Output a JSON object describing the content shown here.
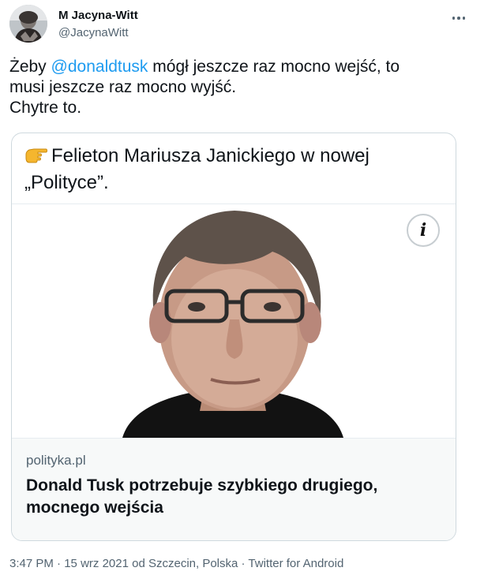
{
  "author": {
    "display_name": "M Jacyna-Witt",
    "handle": "@JacynaWitt"
  },
  "tweet": {
    "line1_prefix": "Żeby ",
    "mention": "@donaldtusk",
    "line1_suffix": " mógł jeszcze raz mocno wejść, to",
    "line2": "musi jeszcze raz mocno wyjść.",
    "line3": "Chytre to."
  },
  "card": {
    "headline_line1": "Felieton Mariusza Janickiego w nowej",
    "headline_line2": "„Polityce”.",
    "info_label": "i",
    "domain": "polityka.pl",
    "title_line1": "Donald Tusk potrzebuje szybkiego drugiego,",
    "title_line2": "mocnego wejścia"
  },
  "meta": {
    "time": "3:47 PM",
    "sep1": " · ",
    "date": "15 wrz 2021",
    "location_prefix": " od ",
    "location": "Szczecin, Polska",
    "sep2": " · ",
    "client": "Twitter for Android"
  },
  "icons": {
    "more": "more-icon",
    "hand": "pointing-hand-icon",
    "info": "info-icon"
  },
  "colors": {
    "accent": "#1d9bf0",
    "secondary_text": "#536471",
    "border": "#cfd9de"
  }
}
